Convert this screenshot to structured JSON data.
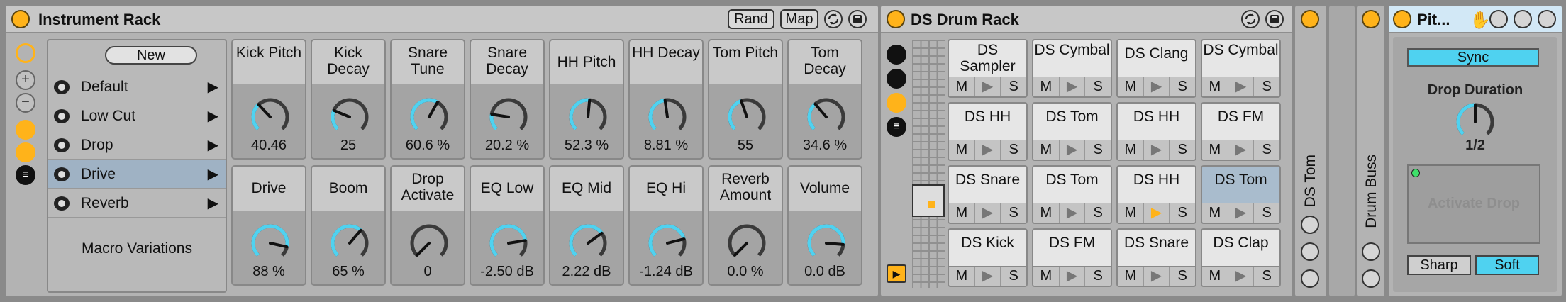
{
  "instrument_rack": {
    "title": "Instrument Rack",
    "rand_label": "Rand",
    "map_label": "Map",
    "new_label": "New",
    "variations": [
      {
        "label": "Default"
      },
      {
        "label": "Low Cut"
      },
      {
        "label": "Drop"
      },
      {
        "label": "Drive",
        "selected": true
      },
      {
        "label": "Reverb"
      }
    ],
    "macro_variations_label": "Macro Variations",
    "macros_row1": [
      {
        "name": "Kick Pitch",
        "value": "40.46",
        "level": 0.34
      },
      {
        "name": "Kick Decay",
        "value": "25",
        "level": 0.25
      },
      {
        "name": "Snare Tune",
        "value": "60.6 %",
        "level": 0.61
      },
      {
        "name": "Snare Decay",
        "value": "20.2 %",
        "level": 0.2
      },
      {
        "name": "HH Pitch",
        "value": "52.3 %",
        "level": 0.52
      },
      {
        "name": "HH Decay",
        "value": "8.81 %",
        "level": 0.47
      },
      {
        "name": "Tom Pitch",
        "value": "55",
        "level": 0.43
      },
      {
        "name": "Tom Decay",
        "value": "34.6 %",
        "level": 0.35
      }
    ],
    "macros_row2": [
      {
        "name": "Drive",
        "value": "88 %",
        "level": 0.88
      },
      {
        "name": "Boom",
        "value": "65 %",
        "level": 0.65
      },
      {
        "name": "Drop Activate",
        "value": "0",
        "level": 0
      },
      {
        "name": "EQ Low",
        "value": "-2.50 dB",
        "level": 0.8
      },
      {
        "name": "EQ Mid",
        "value": "2.22 dB",
        "level": 0.7
      },
      {
        "name": "EQ Hi",
        "value": "-1.24 dB",
        "level": 0.78
      },
      {
        "name": "Reverb Amount",
        "value": "0.0 %",
        "level": 0
      },
      {
        "name": "Volume",
        "value": "0.0 dB",
        "level": 0.85
      }
    ]
  },
  "drum_rack": {
    "title": "DS Drum Rack",
    "pad_controls": [
      "M",
      "▶",
      "S"
    ],
    "pads": [
      {
        "name": "DS Sampler"
      },
      {
        "name": "DS Cymbal"
      },
      {
        "name": "DS Clang"
      },
      {
        "name": "DS Cymbal"
      },
      {
        "name": "DS HH"
      },
      {
        "name": "DS Tom"
      },
      {
        "name": "DS HH"
      },
      {
        "name": "DS FM"
      },
      {
        "name": "DS Snare"
      },
      {
        "name": "DS Tom"
      },
      {
        "name": "DS HH",
        "playing": true
      },
      {
        "name": "DS Tom",
        "selected": true
      },
      {
        "name": "DS Kick"
      },
      {
        "name": "DS FM"
      },
      {
        "name": "DS Snare"
      },
      {
        "name": "DS Clap"
      }
    ]
  },
  "chain_ds_tom": {
    "label": "DS Tom"
  },
  "chain_drum_buss": {
    "label": "Drum Buss"
  },
  "pitch_drop": {
    "title": "Pit...",
    "sync_label": "Sync",
    "drop_duration_label": "Drop Duration",
    "drop_duration_value": "1/2",
    "drop_duration_level": 0.5,
    "activate_label": "Activate Drop",
    "sharp_label": "Sharp",
    "soft_label": "Soft"
  },
  "colors": {
    "accent": "#4fd2f0",
    "power": "#ffb31a",
    "device_bg": "#b3b3b3",
    "selected": "#a9bccd"
  }
}
